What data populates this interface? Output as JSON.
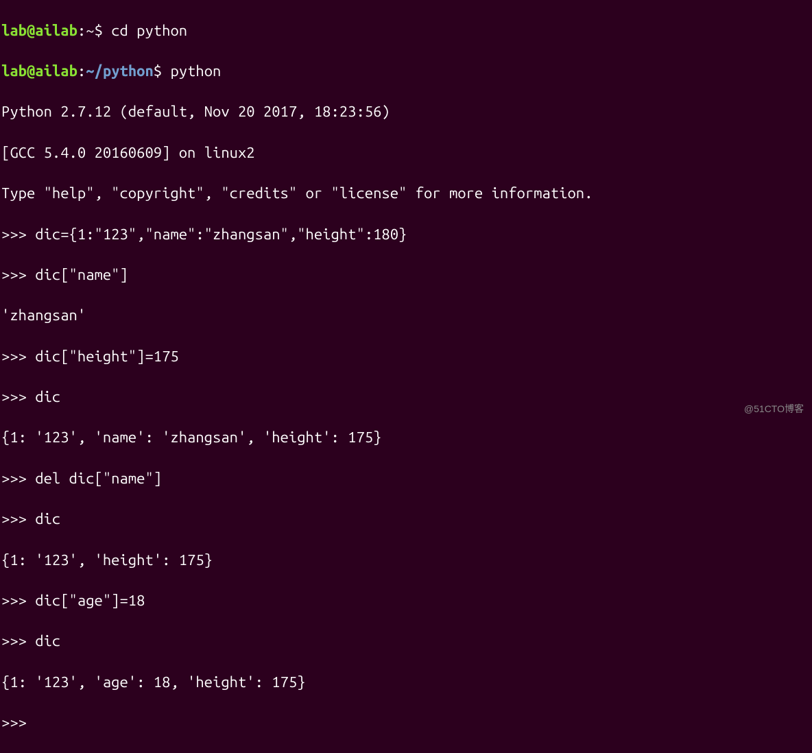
{
  "shell": {
    "user": "lab",
    "host": "ailab",
    "colon": ":",
    "tilde": "~",
    "dollar": "$",
    "path_python": "~/python"
  },
  "commands": {
    "cd": " cd python",
    "python": " python"
  },
  "python_banner": {
    "line1": "Python 2.7.12 (default, Nov 20 2017, 18:23:56)",
    "line2": "[GCC 5.4.0 20160609] on linux2",
    "line3": "Type \"help\", \"copyright\", \"credits\" or \"license\" for more information."
  },
  "repl": {
    "prompt": ">>> ",
    "lines": [
      {
        "in": "dic={1:\"123\",\"name\":\"zhangsan\",\"height\":180}"
      },
      {
        "in": "dic[\"name\"]"
      },
      {
        "out": "'zhangsan'"
      },
      {
        "in": "dic[\"height\"]=175"
      },
      {
        "in": "dic"
      },
      {
        "out": "{1: '123', 'name': 'zhangsan', 'height': 175}"
      },
      {
        "in": "del dic[\"name\"]"
      },
      {
        "in": "dic"
      },
      {
        "out": "{1: '123', 'height': 175}"
      },
      {
        "in": "dic[\"age\"]=18"
      },
      {
        "in": "dic"
      },
      {
        "out": "{1: '123', 'age': 18, 'height': 175}"
      },
      {
        "in": ""
      }
    ]
  },
  "watermark": "@51CTO博客"
}
